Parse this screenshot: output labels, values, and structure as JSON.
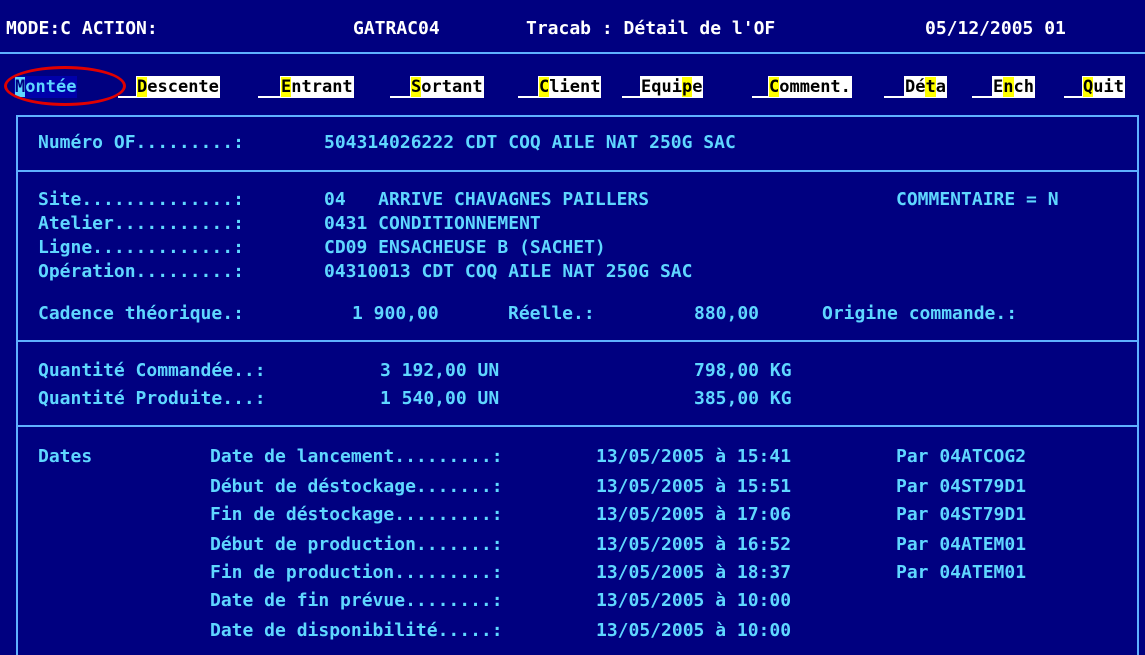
{
  "header": {
    "mode": "MODE:C ACTION:",
    "program": "GATRAC04",
    "title": "Tracab : Détail de l'OF",
    "date": "05/12/2005 01"
  },
  "menu": [
    {
      "hotkey": "M",
      "rest": "ontée",
      "selected": true
    },
    {
      "hotkey": "D",
      "rest": "escente"
    },
    {
      "hotkey": "E",
      "rest": "ntrant"
    },
    {
      "hotkey": "S",
      "rest": "ortant"
    },
    {
      "hotkey": "C",
      "rest": "lient"
    },
    {
      "pre": "Equi",
      "hotkey": "p",
      "rest": "e"
    },
    {
      "hotkey": "C",
      "rest": "omment."
    },
    {
      "pre": "Dé",
      "hotkey": "t",
      "rest": "a"
    },
    {
      "pre": "E",
      "hotkey": "n",
      "rest": "ch"
    },
    {
      "hotkey": "Q",
      "rest": "uit"
    }
  ],
  "of": {
    "label": "Numéro OF.........:",
    "value": "504314026222 CDT COQ AILE NAT 250G SAC"
  },
  "site": {
    "label": "Site..............:",
    "value": "04   ARRIVE CHAVAGNES PAILLERS",
    "commentaire": "COMMENTAIRE = N"
  },
  "atelier": {
    "label": "Atelier...........:",
    "value": "0431 CONDITIONNEMENT"
  },
  "ligne": {
    "label": "Ligne.............:",
    "value": "CD09 ENSACHEUSE B (SACHET)"
  },
  "operation": {
    "label": "Opération.........:",
    "value": "04310013 CDT COQ AILE NAT 250G SAC"
  },
  "cadence": {
    "label": "Cadence théorique.:",
    "theorique": "1 900,00",
    "reelle_label": "Réelle.:",
    "reelle": "880,00",
    "origine_label": "Origine commande.:"
  },
  "quantites": [
    {
      "label": "Quantité Commandée..:",
      "un": "3 192,00 UN",
      "kg": "798,00 KG"
    },
    {
      "label": "Quantité Produite...:",
      "un": "1 540,00 UN",
      "kg": "385,00 KG"
    }
  ],
  "dates": {
    "label": "Dates",
    "rows": [
      {
        "label": "Date de lancement.........:",
        "value": "13/05/2005 à 15:41",
        "par": "Par 04ATCOG2"
      },
      {
        "label": "Début de déstockage.......:",
        "value": "13/05/2005 à 15:51",
        "par": "Par 04ST79D1"
      },
      {
        "label": "Fin de déstockage.........:",
        "value": "13/05/2005 à 17:06",
        "par": "Par 04ST79D1"
      },
      {
        "label": "Début de production.......:",
        "value": "13/05/2005 à 16:52",
        "par": "Par 04ATEM01"
      },
      {
        "label": "Fin de production.........:",
        "value": "13/05/2005 à 18:37",
        "par": "Par 04ATEM01"
      },
      {
        "label": "Date de fin prévue........:",
        "value": "13/05/2005 à 10:00",
        "par": ""
      },
      {
        "label": "Date de disponibilité.....:",
        "value": "13/05/2005 à 10:00",
        "par": ""
      }
    ]
  },
  "colors": {
    "background": "#000080",
    "label_text": "#5fd7ff",
    "frame": "#5fb0ff",
    "hotkey": "#ffff00",
    "annotation": "#e00000"
  }
}
